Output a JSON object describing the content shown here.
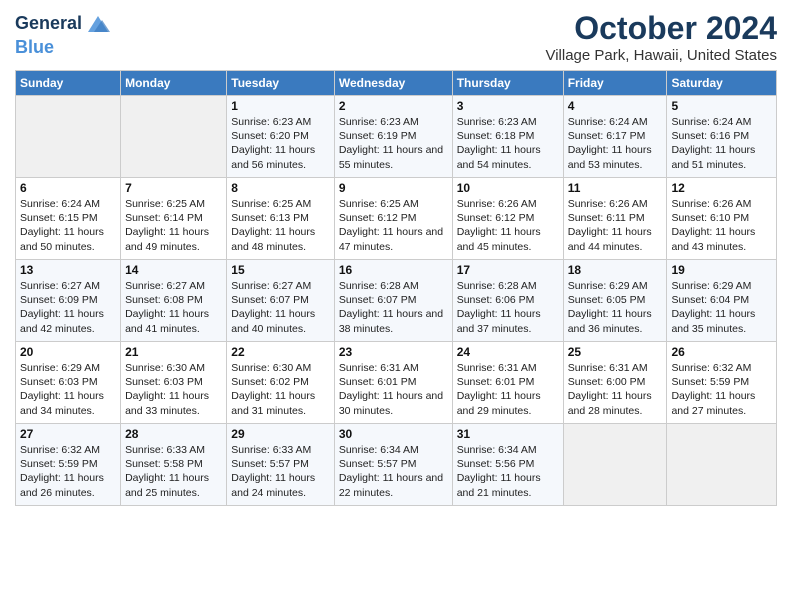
{
  "logo": {
    "text_general": "General",
    "text_blue": "Blue"
  },
  "title": "October 2024",
  "subtitle": "Village Park, Hawaii, United States",
  "days_of_week": [
    "Sunday",
    "Monday",
    "Tuesday",
    "Wednesday",
    "Thursday",
    "Friday",
    "Saturday"
  ],
  "weeks": [
    [
      {
        "day": "",
        "sunrise": "",
        "sunset": "",
        "daylight": "",
        "empty": true
      },
      {
        "day": "",
        "sunrise": "",
        "sunset": "",
        "daylight": "",
        "empty": true
      },
      {
        "day": "1",
        "sunrise": "Sunrise: 6:23 AM",
        "sunset": "Sunset: 6:20 PM",
        "daylight": "Daylight: 11 hours and 56 minutes."
      },
      {
        "day": "2",
        "sunrise": "Sunrise: 6:23 AM",
        "sunset": "Sunset: 6:19 PM",
        "daylight": "Daylight: 11 hours and 55 minutes."
      },
      {
        "day": "3",
        "sunrise": "Sunrise: 6:23 AM",
        "sunset": "Sunset: 6:18 PM",
        "daylight": "Daylight: 11 hours and 54 minutes."
      },
      {
        "day": "4",
        "sunrise": "Sunrise: 6:24 AM",
        "sunset": "Sunset: 6:17 PM",
        "daylight": "Daylight: 11 hours and 53 minutes."
      },
      {
        "day": "5",
        "sunrise": "Sunrise: 6:24 AM",
        "sunset": "Sunset: 6:16 PM",
        "daylight": "Daylight: 11 hours and 51 minutes."
      }
    ],
    [
      {
        "day": "6",
        "sunrise": "Sunrise: 6:24 AM",
        "sunset": "Sunset: 6:15 PM",
        "daylight": "Daylight: 11 hours and 50 minutes."
      },
      {
        "day": "7",
        "sunrise": "Sunrise: 6:25 AM",
        "sunset": "Sunset: 6:14 PM",
        "daylight": "Daylight: 11 hours and 49 minutes."
      },
      {
        "day": "8",
        "sunrise": "Sunrise: 6:25 AM",
        "sunset": "Sunset: 6:13 PM",
        "daylight": "Daylight: 11 hours and 48 minutes."
      },
      {
        "day": "9",
        "sunrise": "Sunrise: 6:25 AM",
        "sunset": "Sunset: 6:12 PM",
        "daylight": "Daylight: 11 hours and 47 minutes."
      },
      {
        "day": "10",
        "sunrise": "Sunrise: 6:26 AM",
        "sunset": "Sunset: 6:12 PM",
        "daylight": "Daylight: 11 hours and 45 minutes."
      },
      {
        "day": "11",
        "sunrise": "Sunrise: 6:26 AM",
        "sunset": "Sunset: 6:11 PM",
        "daylight": "Daylight: 11 hours and 44 minutes."
      },
      {
        "day": "12",
        "sunrise": "Sunrise: 6:26 AM",
        "sunset": "Sunset: 6:10 PM",
        "daylight": "Daylight: 11 hours and 43 minutes."
      }
    ],
    [
      {
        "day": "13",
        "sunrise": "Sunrise: 6:27 AM",
        "sunset": "Sunset: 6:09 PM",
        "daylight": "Daylight: 11 hours and 42 minutes."
      },
      {
        "day": "14",
        "sunrise": "Sunrise: 6:27 AM",
        "sunset": "Sunset: 6:08 PM",
        "daylight": "Daylight: 11 hours and 41 minutes."
      },
      {
        "day": "15",
        "sunrise": "Sunrise: 6:27 AM",
        "sunset": "Sunset: 6:07 PM",
        "daylight": "Daylight: 11 hours and 40 minutes."
      },
      {
        "day": "16",
        "sunrise": "Sunrise: 6:28 AM",
        "sunset": "Sunset: 6:07 PM",
        "daylight": "Daylight: 11 hours and 38 minutes."
      },
      {
        "day": "17",
        "sunrise": "Sunrise: 6:28 AM",
        "sunset": "Sunset: 6:06 PM",
        "daylight": "Daylight: 11 hours and 37 minutes."
      },
      {
        "day": "18",
        "sunrise": "Sunrise: 6:29 AM",
        "sunset": "Sunset: 6:05 PM",
        "daylight": "Daylight: 11 hours and 36 minutes."
      },
      {
        "day": "19",
        "sunrise": "Sunrise: 6:29 AM",
        "sunset": "Sunset: 6:04 PM",
        "daylight": "Daylight: 11 hours and 35 minutes."
      }
    ],
    [
      {
        "day": "20",
        "sunrise": "Sunrise: 6:29 AM",
        "sunset": "Sunset: 6:03 PM",
        "daylight": "Daylight: 11 hours and 34 minutes."
      },
      {
        "day": "21",
        "sunrise": "Sunrise: 6:30 AM",
        "sunset": "Sunset: 6:03 PM",
        "daylight": "Daylight: 11 hours and 33 minutes."
      },
      {
        "day": "22",
        "sunrise": "Sunrise: 6:30 AM",
        "sunset": "Sunset: 6:02 PM",
        "daylight": "Daylight: 11 hours and 31 minutes."
      },
      {
        "day": "23",
        "sunrise": "Sunrise: 6:31 AM",
        "sunset": "Sunset: 6:01 PM",
        "daylight": "Daylight: 11 hours and 30 minutes."
      },
      {
        "day": "24",
        "sunrise": "Sunrise: 6:31 AM",
        "sunset": "Sunset: 6:01 PM",
        "daylight": "Daylight: 11 hours and 29 minutes."
      },
      {
        "day": "25",
        "sunrise": "Sunrise: 6:31 AM",
        "sunset": "Sunset: 6:00 PM",
        "daylight": "Daylight: 11 hours and 28 minutes."
      },
      {
        "day": "26",
        "sunrise": "Sunrise: 6:32 AM",
        "sunset": "Sunset: 5:59 PM",
        "daylight": "Daylight: 11 hours and 27 minutes."
      }
    ],
    [
      {
        "day": "27",
        "sunrise": "Sunrise: 6:32 AM",
        "sunset": "Sunset: 5:59 PM",
        "daylight": "Daylight: 11 hours and 26 minutes."
      },
      {
        "day": "28",
        "sunrise": "Sunrise: 6:33 AM",
        "sunset": "Sunset: 5:58 PM",
        "daylight": "Daylight: 11 hours and 25 minutes."
      },
      {
        "day": "29",
        "sunrise": "Sunrise: 6:33 AM",
        "sunset": "Sunset: 5:57 PM",
        "daylight": "Daylight: 11 hours and 24 minutes."
      },
      {
        "day": "30",
        "sunrise": "Sunrise: 6:34 AM",
        "sunset": "Sunset: 5:57 PM",
        "daylight": "Daylight: 11 hours and 22 minutes."
      },
      {
        "day": "31",
        "sunrise": "Sunrise: 6:34 AM",
        "sunset": "Sunset: 5:56 PM",
        "daylight": "Daylight: 11 hours and 21 minutes."
      },
      {
        "day": "",
        "sunrise": "",
        "sunset": "",
        "daylight": "",
        "empty": true
      },
      {
        "day": "",
        "sunrise": "",
        "sunset": "",
        "daylight": "",
        "empty": true
      }
    ]
  ]
}
